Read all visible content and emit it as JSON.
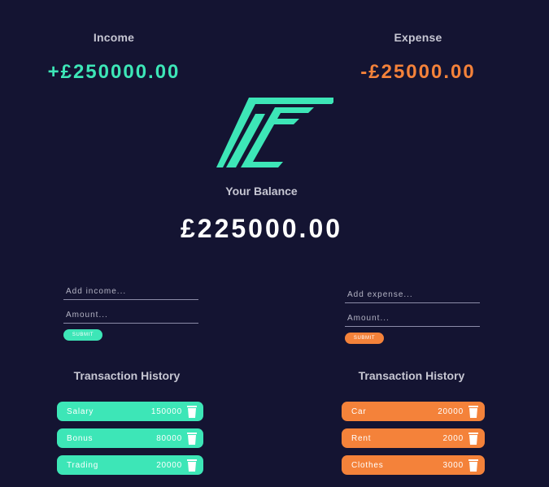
{
  "summary": {
    "income_label": "Income",
    "income_value": "+£250000.00",
    "expense_label": "Expense",
    "expense_value": "-£25000.00"
  },
  "logo": {
    "icon": "brand-logo"
  },
  "balance": {
    "label": "Your Balance",
    "value": "£225000.00"
  },
  "income_form": {
    "description_placeholder": "Add income...",
    "amount_placeholder": "Amount...",
    "submit_label": "SUBMIT"
  },
  "expense_form": {
    "description_placeholder": "Add expense...",
    "amount_placeholder": "Amount...",
    "submit_label": "SUBMIT"
  },
  "income_history": {
    "title": "Transaction History",
    "items": [
      {
        "name": "Salary",
        "amount": "150000"
      },
      {
        "name": "Bonus",
        "amount": "80000"
      },
      {
        "name": "Trading",
        "amount": "20000"
      }
    ]
  },
  "expense_history": {
    "title": "Transaction History",
    "items": [
      {
        "name": "Car",
        "amount": "20000"
      },
      {
        "name": "Rent",
        "amount": "2000"
      },
      {
        "name": "Clothes",
        "amount": "3000"
      }
    ]
  },
  "colors": {
    "background": "#141432",
    "income_accent": "#3de6b7",
    "expense_accent": "#f4823a",
    "text_muted": "#c6c6d2",
    "text_bright": "#ffffff"
  },
  "icons": {
    "delete": "trash-icon"
  }
}
